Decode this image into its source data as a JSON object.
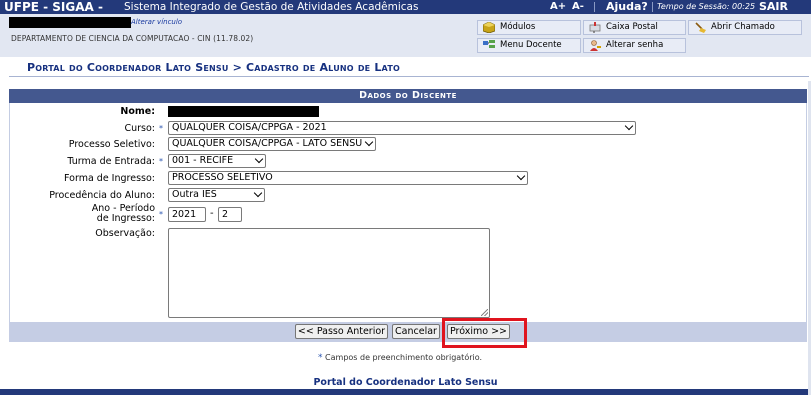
{
  "topbar": {
    "app_name": "UFPE - SIGAA -",
    "system_name": "Sistema Integrado de Gestão de Atividades Acadêmicas",
    "font_increase": "A+",
    "font_decrease": "A-",
    "help": "Ajuda?",
    "session_label": "Tempo de Sessão: 00:25",
    "logout": "SAIR"
  },
  "infobar": {
    "change_link": "Alterar vínculo",
    "department": "DEPARTAMENTO DE CIENCIA DA COMPUTACAO - CIN (11.78.02)",
    "menu": {
      "modulos": "Módulos",
      "caixa_postal": "Caixa Postal",
      "abrir_chamado": "Abrir Chamado",
      "menu_docente": "Menu Docente",
      "alterar_senha": "Alterar senha"
    }
  },
  "page_title": "Portal do Coordenador Lato Sensu > Cadastro de Aluno de Lato",
  "form": {
    "header": "Dados do Discente",
    "labels": {
      "nome": "Nome:",
      "curso": "Curso:",
      "processo": "Processo Seletivo:",
      "turma": "Turma de Entrada:",
      "forma": "Forma de Ingresso:",
      "procedencia": "Procedência do Aluno:",
      "ano_periodo_1": "Ano - Período",
      "ano_periodo_2": "de Ingresso:",
      "observacao": "Observação:"
    },
    "values": {
      "curso": "QUALQUER COISA/CPPGA - 2021",
      "processo": "QUALQUER COISA/CPPGA - LATO SENSU",
      "turma": "001 - RECIFE",
      "forma": "PROCESSO SELETIVO",
      "procedencia": "Outra IES",
      "ano": "2021",
      "periodo": "2",
      "observacao": ""
    },
    "required_marker": "*",
    "dash": "-",
    "buttons": {
      "previous": "<< Passo Anterior",
      "cancel": "Cancelar",
      "next": "Próximo >>"
    }
  },
  "required_note": "Campos de preenchimento obrigatório.",
  "footer_title": "Portal do Coordenador Lato Sensu",
  "colors": {
    "header_navy": "#23397a",
    "panel_header": "#44588f",
    "highlight": "#e0141e",
    "required_star": "#2c56b0"
  }
}
